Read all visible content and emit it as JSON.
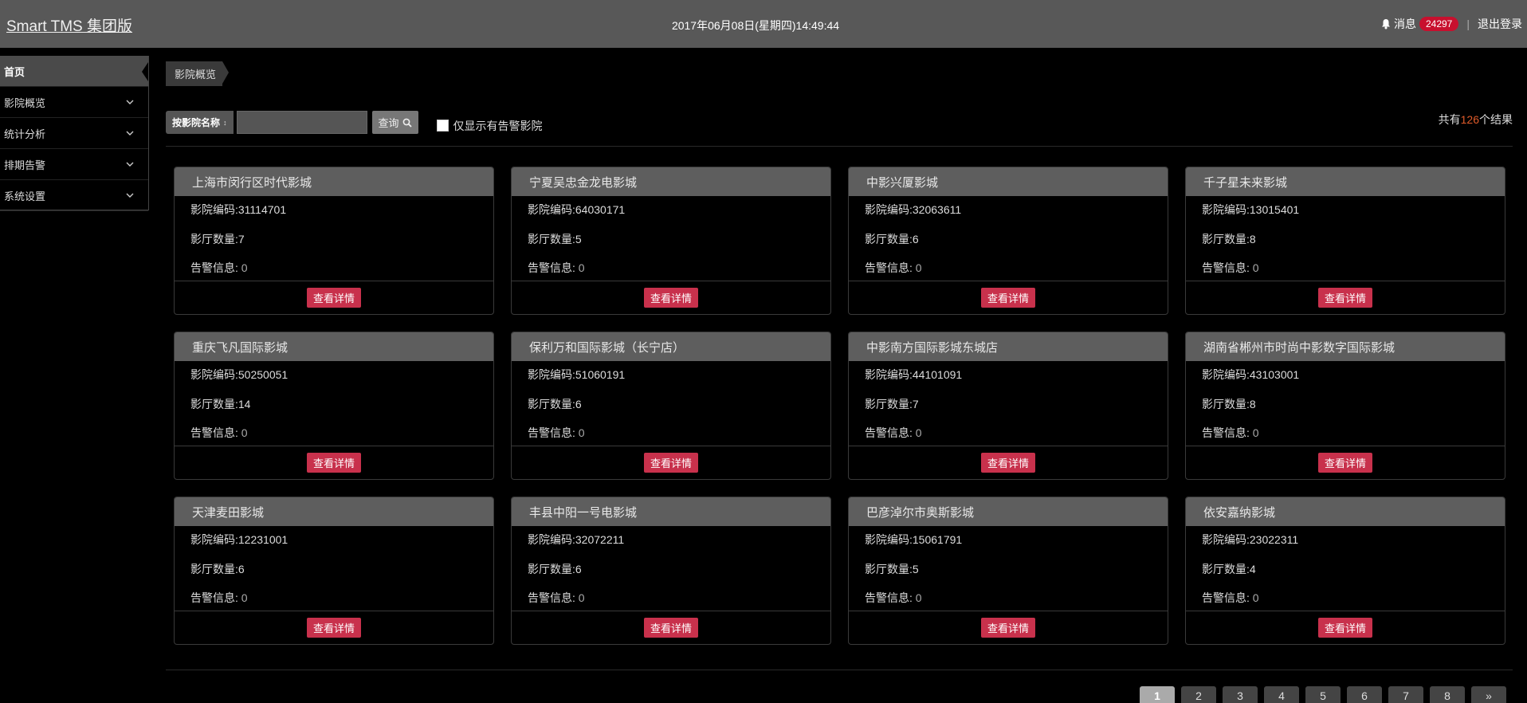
{
  "header": {
    "brand": "Smart TMS 集团版",
    "datetime": "2017年06月08日(星期四)14:49:44",
    "messages_label": "消息",
    "messages_count": "24297",
    "separator": "|",
    "logout": "退出登录"
  },
  "sidebar": {
    "items": [
      {
        "label": "首页",
        "active": true
      },
      {
        "label": "影院概览"
      },
      {
        "label": "统计分析"
      },
      {
        "label": "排期告警"
      },
      {
        "label": "系统设置"
      }
    ]
  },
  "breadcrumb": {
    "current": "影院概览"
  },
  "search": {
    "select_label": "按影院名称",
    "input_value": "",
    "query_label": "查询",
    "checkbox_label": "仅显示有告警影院",
    "total_prefix": "共有",
    "total_count": "126",
    "total_suffix": "个结果"
  },
  "cards": [
    {
      "name": "上海市闵行区时代影城",
      "code": "影院编码:31114701",
      "halls": "影厅数量:7",
      "alarm_label": "告警信息:",
      "alarm_value": "0",
      "button": "查看详情"
    },
    {
      "name": "宁夏吴忠金龙电影城",
      "code": "影院编码:64030171",
      "halls": "影厅数量:5",
      "alarm_label": "告警信息:",
      "alarm_value": "0",
      "button": "查看详情"
    },
    {
      "name": "中影兴厦影城",
      "code": "影院编码:32063611",
      "halls": "影厅数量:6",
      "alarm_label": "告警信息:",
      "alarm_value": "0",
      "button": "查看详情"
    },
    {
      "name": "千子星未来影城",
      "code": "影院编码:13015401",
      "halls": "影厅数量:8",
      "alarm_label": "告警信息:",
      "alarm_value": "0",
      "button": "查看详情"
    },
    {
      "name": "重庆飞凡国际影城",
      "code": "影院编码:50250051",
      "halls": "影厅数量:14",
      "alarm_label": "告警信息:",
      "alarm_value": "0",
      "button": "查看详情"
    },
    {
      "name": "保利万和国际影城（长宁店）",
      "code": "影院编码:51060191",
      "halls": "影厅数量:6",
      "alarm_label": "告警信息:",
      "alarm_value": "0",
      "button": "查看详情"
    },
    {
      "name": "中影南方国际影城东城店",
      "code": "影院编码:44101091",
      "halls": "影厅数量:7",
      "alarm_label": "告警信息:",
      "alarm_value": "0",
      "button": "查看详情"
    },
    {
      "name": "湖南省郴州市时尚中影数字国际影城",
      "code": "影院编码:43103001",
      "halls": "影厅数量:8",
      "alarm_label": "告警信息:",
      "alarm_value": "0",
      "button": "查看详情"
    },
    {
      "name": "天津麦田影城",
      "code": "影院编码:12231001",
      "halls": "影厅数量:6",
      "alarm_label": "告警信息:",
      "alarm_value": "0",
      "button": "查看详情"
    },
    {
      "name": "丰县中阳一号电影城",
      "code": "影院编码:32072211",
      "halls": "影厅数量:6",
      "alarm_label": "告警信息:",
      "alarm_value": "0",
      "button": "查看详情"
    },
    {
      "name": "巴彦淖尔市奥斯影城",
      "code": "影院编码:15061791",
      "halls": "影厅数量:5",
      "alarm_label": "告警信息:",
      "alarm_value": "0",
      "button": "查看详情"
    },
    {
      "name": "依安嘉纳影城",
      "code": "影院编码:23022311",
      "halls": "影厅数量:4",
      "alarm_label": "告警信息:",
      "alarm_value": "0",
      "button": "查看详情"
    }
  ],
  "pagination": {
    "pages": [
      "1",
      "2",
      "3",
      "4",
      "5",
      "6",
      "7",
      "8",
      "»"
    ],
    "active": "1"
  },
  "colors": {
    "accent": "#c8314c",
    "badge": "#c8102e",
    "count_highlight": "#e15b2a"
  }
}
